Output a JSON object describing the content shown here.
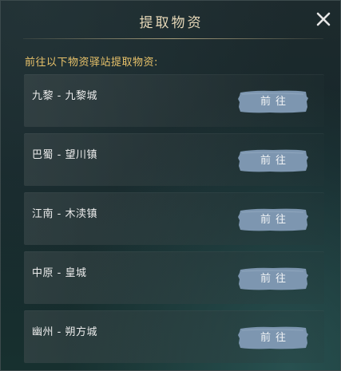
{
  "dialog": {
    "title": "提取物资",
    "close_icon": "close-icon",
    "intro": "前往以下物资驿站提取物资:"
  },
  "stations": [
    {
      "name": "九黎 - 九黎城",
      "button": "前往"
    },
    {
      "name": "巴蜀 - 望川镇",
      "button": "前往"
    },
    {
      "name": "江南 - 木渎镇",
      "button": "前往"
    },
    {
      "name": "中原 - 皇城",
      "button": "前往"
    },
    {
      "name": "幽州 - 朔方城",
      "button": "前往"
    }
  ],
  "colors": {
    "title": "#e7d8b8",
    "intro": "#e8c26a",
    "button_fill": "#7d96b0",
    "panel_bg": "#1a2b2d"
  }
}
